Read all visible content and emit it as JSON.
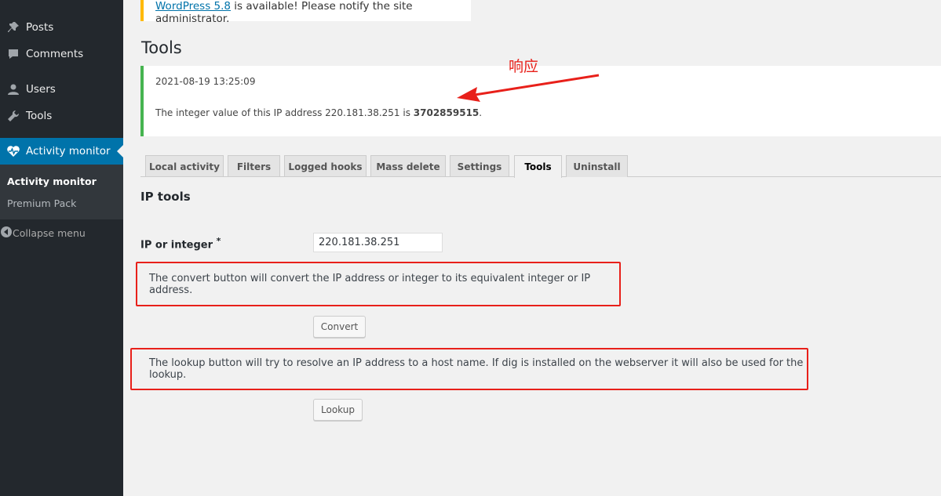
{
  "sidebar": {
    "items": [
      {
        "label": "Posts",
        "icon": "pin-icon"
      },
      {
        "label": "Comments",
        "icon": "comment-icon"
      },
      {
        "label": "Users",
        "icon": "user-icon"
      },
      {
        "label": "Tools",
        "icon": "wrench-icon"
      },
      {
        "label": "Activity monitor",
        "icon": "heart-pulse-icon"
      }
    ],
    "submenu": [
      "Activity monitor",
      "Premium Pack"
    ],
    "collapse_label": "Collapse menu"
  },
  "notice": {
    "link": "WordPress 5.8",
    "text": " is available! Please notify the site administrator."
  },
  "page_title": "Tools",
  "result": {
    "timestamp": "2021-08-19 13:25:09",
    "text_prefix": "The integer value of this IP address 220.181.38.251 is ",
    "value": "3702859515",
    "text_suffix": "."
  },
  "annotation": "响应",
  "tabs": [
    "Local activity",
    "Filters",
    "Logged hooks",
    "Mass delete",
    "Settings",
    "Tools",
    "Uninstall"
  ],
  "active_tab": "Tools",
  "ip_tools": {
    "title": "IP tools",
    "field_label": "IP or integer",
    "required_mark": "*",
    "field_value": "220.181.38.251",
    "convert_desc": "The convert button will convert the IP address or integer to its equivalent integer or IP address.",
    "convert_label": "Convert",
    "lookup_desc": "The lookup button will try to resolve an IP address to a host name. If dig is installed on the webserver it will also be used for the lookup.",
    "lookup_label": "Lookup"
  },
  "colors": {
    "sidebar_bg": "#23282d",
    "active_menu": "#0073aa",
    "success_border": "#46b450",
    "warning_border": "#ffb900",
    "annotation_red": "#e8201a"
  }
}
